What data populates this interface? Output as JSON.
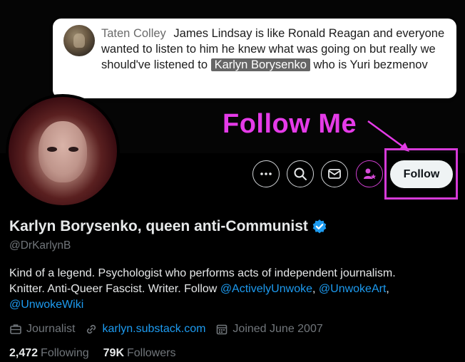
{
  "comment": {
    "author": "Taten Colley",
    "text_part1": "James Lindsay is like Ronald Reagan and everyone wanted to listen to him he knew what was going on but really we should've listened to",
    "highlight": "Karlyn Borysenko",
    "text_part2": "who is Yuri bezmenov"
  },
  "annotation": {
    "callout": "Follow Me",
    "color": "#e53be8"
  },
  "actions": {
    "more_icon": "more-horizontal-icon",
    "search_icon": "search-icon",
    "message_icon": "envelope-icon",
    "notify_icon": "person-star-icon",
    "follow_label": "Follow"
  },
  "profile": {
    "display_name": "Karlyn Borysenko, queen anti-Communist",
    "handle": "@DrKarlynB",
    "verified_color": "#1d9bf0",
    "bio_line1": "Kind of a legend. Psychologist who performs acts of independent journalism.",
    "bio_line2_text": "Knitter. Anti-Queer Fascist. Writer. Follow",
    "mention1": "@ActivelyUnwoke",
    "sep1": ",",
    "mention2": "@UnwokeArt",
    "sep2": ",",
    "mention3": "@UnwokeWiki",
    "category": "Journalist",
    "website": "karlyn.substack.com",
    "joined": "Joined June 2007",
    "following_count": "2,472",
    "following_label": "Following",
    "followers_count": "79K",
    "followers_label": "Followers"
  }
}
